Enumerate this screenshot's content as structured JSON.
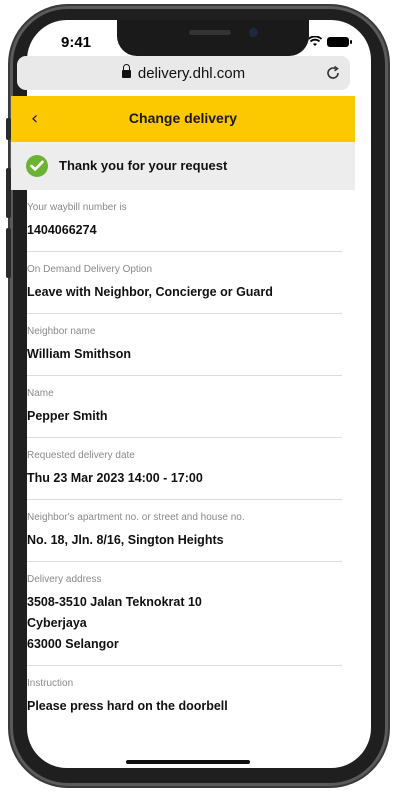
{
  "status_bar": {
    "time": "9:41"
  },
  "browser": {
    "url": "delivery.dhl.com",
    "lock_icon": "lock-icon",
    "reload_icon": "reload-icon"
  },
  "header": {
    "title": "Change delivery",
    "back_icon": "chevron-left-icon",
    "color": "#fcc900"
  },
  "confirmation": {
    "message": "Thank you for your request",
    "icon": "check-circle-icon",
    "icon_color": "#6bb431"
  },
  "fields": [
    {
      "label": "Your waybill number is",
      "value": [
        "1404066274"
      ]
    },
    {
      "label": "On Demand Delivery Option",
      "value": [
        "Leave with Neighbor, Concierge or Guard"
      ]
    },
    {
      "label": "Neighbor name",
      "value": [
        "William Smithson"
      ]
    },
    {
      "label": "Name",
      "value": [
        "Pepper Smith"
      ]
    },
    {
      "label": "Requested delivery date",
      "value": [
        "Thu 23 Mar 2023 14:00 - 17:00"
      ]
    },
    {
      "label": "Neighbor's apartment no. or street and house no.",
      "value": [
        "No. 18, Jln. 8/16, Sington Heights"
      ]
    },
    {
      "label": "Delivery address",
      "value": [
        "3508-3510 Jalan Teknokrat 10",
        "Cyberjaya",
        "63000 Selangor"
      ]
    },
    {
      "label": "Instruction",
      "value": [
        "Please press hard on the doorbell"
      ]
    }
  ]
}
